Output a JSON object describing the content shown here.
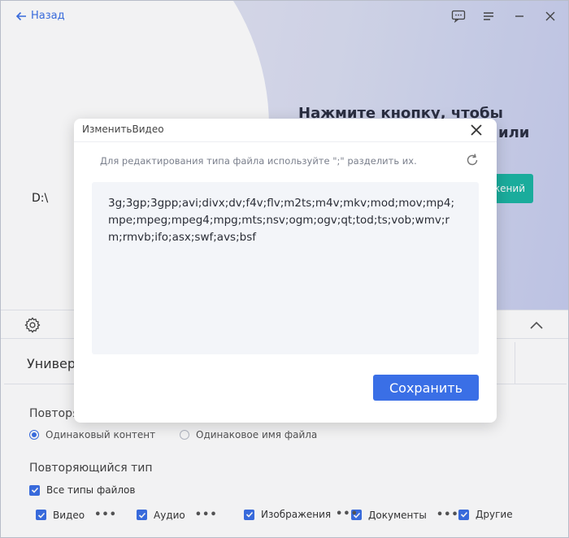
{
  "header": {
    "back_label": "Назад",
    "icons": [
      "feedback-icon",
      "menu-icon",
      "minimize-icon",
      "close-icon"
    ]
  },
  "hero": {
    "title_line1": "Нажмите кнопку, чтобы",
    "title_line2": "или",
    "button_label": "жений",
    "drive_path": "D:\\"
  },
  "settings": {
    "tab_label": "Универ",
    "duplicates_label": "Повторя",
    "radio_same_content": "Одинаковый контент",
    "radio_same_name": "Одинаковое имя файла",
    "duplicate_type_label": "Повторяющийся тип",
    "all_types_label": "Все типы файлов",
    "types": [
      {
        "label": "Видео",
        "more": "•••"
      },
      {
        "label": "Аудио",
        "more": "•••"
      },
      {
        "label": "Изображения",
        "more": "•••"
      },
      {
        "label": "Документы",
        "more": "•••"
      },
      {
        "label": "Другие"
      }
    ]
  },
  "modal": {
    "title": "ИзменитьВидео",
    "hint": "Для редактирования типа файла используйте \";\" разделить их.",
    "extensions": "3g;3gp;3gpp;avi;divx;dv;f4v;flv;m2ts;m4v;mkv;mod;mov;mp4;mpe;mpeg;mpeg4;mpg;mts;nsv;ogm;ogv;qt;tod;ts;vob;wmv;rm;rmvb;ifo;asx;swf;avs;bsf",
    "save_label": "Сохранить"
  },
  "colors": {
    "accent": "#3a6fe6",
    "teal": "#1ab5a3"
  }
}
